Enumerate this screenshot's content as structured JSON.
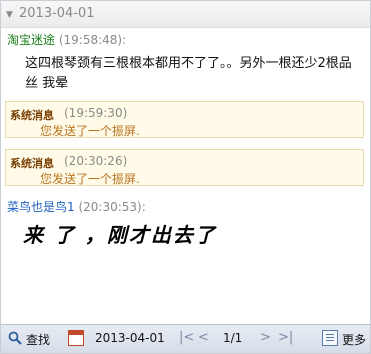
{
  "header": {
    "date": "2013-04-01"
  },
  "messages": [
    {
      "sender": "淘宝迷途",
      "time": "(19:58:48):",
      "text": "这四根琴颈有三根根本都用不了了。。另外一根还少2根品丝 我晕"
    },
    {
      "sender": "菜鸟也是鸟1",
      "time": "(20:30:53):",
      "text": "来 了 ，刚才出去了"
    }
  ],
  "system_messages": [
    {
      "label": "系统消息",
      "time": "(19:59:30)",
      "text": "您发送了一个振屏."
    },
    {
      "label": "系统消息",
      "time": "(20:30:26)",
      "text": "您发送了一个振屏."
    }
  ],
  "toolbar": {
    "search_label": "查找",
    "date": "2013-04-01",
    "first": "|<",
    "prev": "<",
    "page": "1/1",
    "next": ">",
    "last": ">|",
    "more_label": "更多"
  },
  "icons": {
    "search": "search-icon",
    "calendar": "calendar-icon",
    "more": "more-icon"
  },
  "colors": {
    "sender_taobao": "#1b7f1b",
    "sender_cainiao": "#1f5fbf",
    "system_label": "#7a3d00",
    "system_text": "#b87420",
    "system_bg": "#fffbe8"
  }
}
